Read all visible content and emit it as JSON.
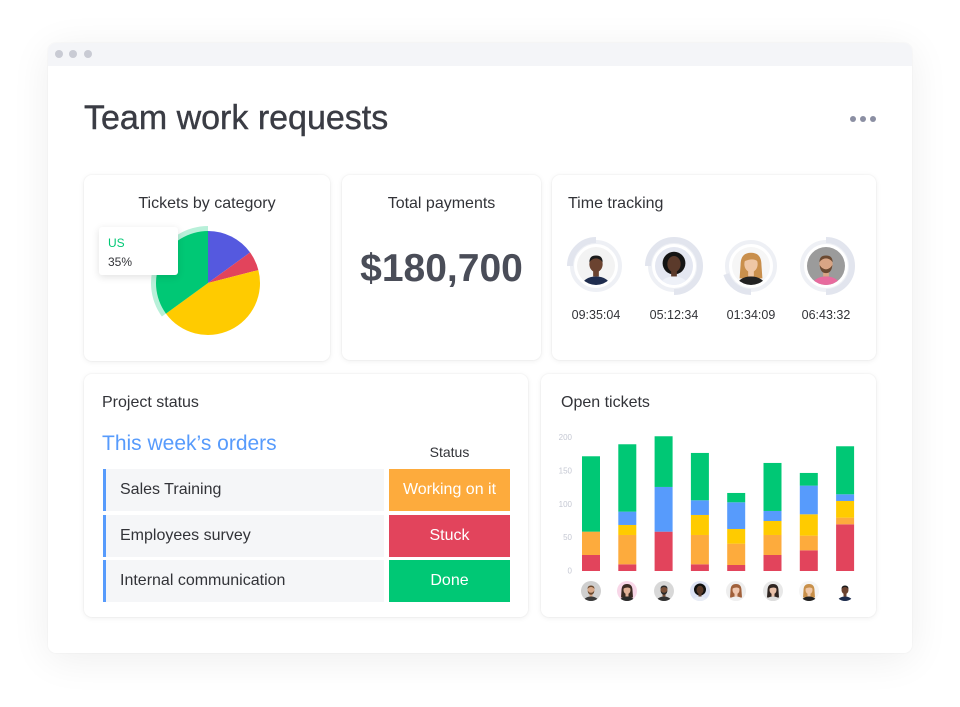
{
  "header": {
    "title": "Team work requests",
    "menu_icon": "more-horizontal-icon"
  },
  "tickets_card": {
    "title": "Tickets by category",
    "tooltip": {
      "label": "US",
      "value": "35%"
    }
  },
  "payments_card": {
    "title": "Total payments",
    "amount": "$180,700"
  },
  "time_tracking_card": {
    "title": "Time tracking",
    "members": [
      {
        "time": "09:35:04",
        "progress_start": 0.75,
        "progress": 0.25,
        "avatar": {
          "bg": "#f3f3f3",
          "skin": "#6b4330",
          "hair": "#1b1b1b",
          "shirt": "#1f2d4f",
          "hair_style": "short"
        }
      },
      {
        "time": "05:12:34",
        "progress_start": 0.75,
        "progress": 0.75,
        "avatar": {
          "bg": "#e4e7f1",
          "skin": "#5b3a2b",
          "hair": "#141414",
          "shirt": "#eef1f8",
          "hair_style": "curly"
        }
      },
      {
        "time": "01:34:09",
        "progress_start": 0.5,
        "progress": 0.2,
        "avatar": {
          "bg": "#f6f6f6",
          "skin": "#efc7a6",
          "hair": "#c98f4c",
          "shirt": "#222222",
          "hair_style": "long"
        }
      },
      {
        "time": "06:43:32",
        "progress_start": 0.0,
        "progress": 0.5,
        "avatar": {
          "bg": "#9b9b9b",
          "skin": "#d9a585",
          "hair": "#6b4a32",
          "shirt": "#e76b9e",
          "hair_style": "beard"
        }
      }
    ]
  },
  "project_status_card": {
    "title": "Project status",
    "group_title": "This week’s orders",
    "status_header": "Status",
    "rows": [
      {
        "name": "Sales Training",
        "status": "Working on it",
        "color": "#fdab3d"
      },
      {
        "name": "Employees survey",
        "status": "Stuck",
        "color": "#e2445c"
      },
      {
        "name": "Internal communication",
        "status": "Done",
        "color": "#00c875"
      }
    ]
  },
  "open_tickets_card": {
    "title": "Open tickets",
    "assignees": [
      {
        "bg": "#cfcfcf",
        "skin": "#d8a888",
        "hair": "#6a4a30",
        "shirt": "#3a3a3a",
        "hair_style": "beard"
      },
      {
        "bg": "#f8d7e8",
        "skin": "#e0b096",
        "hair": "#3a2a22",
        "shirt": "#2a2a2a",
        "hair_style": "long"
      },
      {
        "bg": "#d8d8d8",
        "skin": "#7a5038",
        "hair": "#2a2a2a",
        "shirt": "#333333",
        "hair_style": "beard"
      },
      {
        "bg": "#dde3f5",
        "skin": "#5a3a2a",
        "hair": "#111111",
        "shirt": "#e8ecf5",
        "hair_style": "curly"
      },
      {
        "bg": "#eeeeee",
        "skin": "#f0c8b0",
        "hair": "#a0603a",
        "shirt": "#f0f0f0",
        "hair_style": "long"
      },
      {
        "bg": "#e8e8e8",
        "skin": "#e8c0a8",
        "hair": "#2e2420",
        "shirt": "#dddddd",
        "hair_style": "long"
      },
      {
        "bg": "#f5f5f5",
        "skin": "#f0c8a8",
        "hair": "#c8904a",
        "shirt": "#222222",
        "hair_style": "long"
      },
      {
        "bg": "#ffffff",
        "skin": "#6b4330",
        "hair": "#1a1a1a",
        "shirt": "#1d2c4d",
        "hair_style": "short"
      }
    ]
  },
  "colors": {
    "accent_blue": "#579bfc",
    "status_working": "#fdab3d",
    "status_stuck": "#e2445c",
    "status_done": "#00c875",
    "ring_track": "#eef0f5",
    "ring_progress": "#e2e5ee",
    "axis_label": "#c5c8d3"
  },
  "chart_data": [
    {
      "type": "pie",
      "title": "Tickets by category",
      "start": "12 o'clock, clockwise",
      "slices": [
        {
          "label": "",
          "value": 15,
          "color": "#5559df"
        },
        {
          "label": "",
          "value": 6,
          "color": "#e2445c"
        },
        {
          "label": "",
          "value": 44,
          "color": "#ffcb00"
        },
        {
          "label": "US",
          "value": 35,
          "color": "#00c875",
          "highlighted": true
        }
      ],
      "tooltip": {
        "label": "US",
        "value": "35%"
      },
      "legend": null
    },
    {
      "type": "bar",
      "stacked": true,
      "title": "Open tickets",
      "categories": [
        "assignee-1",
        "assignee-2",
        "assignee-3",
        "assignee-4",
        "assignee-5",
        "assignee-6",
        "assignee-7",
        "assignee-8"
      ],
      "xlabel": "",
      "ylabel": "",
      "ylim": [
        0,
        200
      ],
      "yticks": [
        0,
        50,
        100,
        150,
        200
      ],
      "grid": false,
      "legend": null,
      "series": [
        {
          "name": "red",
          "color": "#e2445c",
          "values": [
            24,
            10,
            59,
            10,
            9,
            24,
            31,
            70
          ]
        },
        {
          "name": "orange",
          "color": "#fdab3d",
          "values": [
            35,
            44,
            0,
            44,
            32,
            30,
            22,
            10
          ]
        },
        {
          "name": "yellow",
          "color": "#ffcb00",
          "values": [
            0,
            15,
            0,
            30,
            22,
            21,
            32,
            25
          ]
        },
        {
          "name": "blue",
          "color": "#579bfc",
          "values": [
            0,
            20,
            67,
            22,
            40,
            15,
            43,
            10
          ]
        },
        {
          "name": "green",
          "color": "#00c875",
          "values": [
            113,
            101,
            76,
            71,
            14,
            72,
            19,
            72
          ]
        }
      ]
    }
  ]
}
